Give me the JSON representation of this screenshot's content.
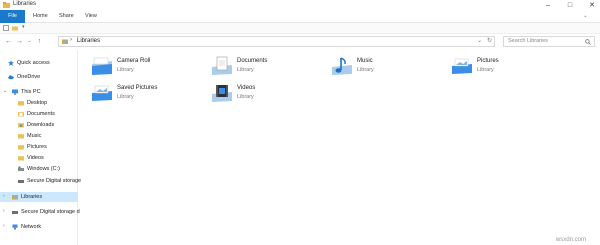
{
  "window": {
    "title": "Libraries"
  },
  "ribbon": {
    "tabs": [
      "File",
      "Home",
      "Share",
      "View"
    ]
  },
  "address": {
    "crumb": "Libraries",
    "separator": "›"
  },
  "search": {
    "placeholder": "Search Libraries"
  },
  "nav": {
    "items": [
      {
        "label": "Quick access",
        "icon": "star-icon"
      },
      {
        "label": "OneDrive",
        "icon": "cloud-icon"
      },
      {
        "label": "This PC",
        "icon": "computer-icon"
      },
      {
        "label": "Desktop",
        "icon": "folder-icon"
      },
      {
        "label": "Documents",
        "icon": "folder-icon"
      },
      {
        "label": "Downloads",
        "icon": "folder-icon"
      },
      {
        "label": "Music",
        "icon": "folder-icon"
      },
      {
        "label": "Pictures",
        "icon": "folder-icon"
      },
      {
        "label": "Videos",
        "icon": "folder-icon"
      },
      {
        "label": "Windows (C:)",
        "icon": "drive-icon"
      },
      {
        "label": "Secure Digital storage",
        "icon": "drive-icon"
      },
      {
        "label": "Libraries",
        "icon": "libraries-icon"
      },
      {
        "label": "Secure Digital storage d",
        "icon": "drive-icon"
      },
      {
        "label": "Network",
        "icon": "network-icon"
      }
    ]
  },
  "libraries": [
    {
      "name": "Camera Roll",
      "type": "Library",
      "icon": "camera-roll-library-icon"
    },
    {
      "name": "Documents",
      "type": "Library",
      "icon": "documents-library-icon"
    },
    {
      "name": "Music",
      "type": "Library",
      "icon": "music-library-icon"
    },
    {
      "name": "Pictures",
      "type": "Library",
      "icon": "pictures-library-icon"
    },
    {
      "name": "Saved Pictures",
      "type": "Library",
      "icon": "saved-pictures-library-icon"
    },
    {
      "name": "Videos",
      "type": "Library",
      "icon": "videos-library-icon"
    }
  ],
  "watermark": "wsxdn.com",
  "colors": {
    "accent": "#1979ca",
    "selected": "#cce8ff"
  }
}
